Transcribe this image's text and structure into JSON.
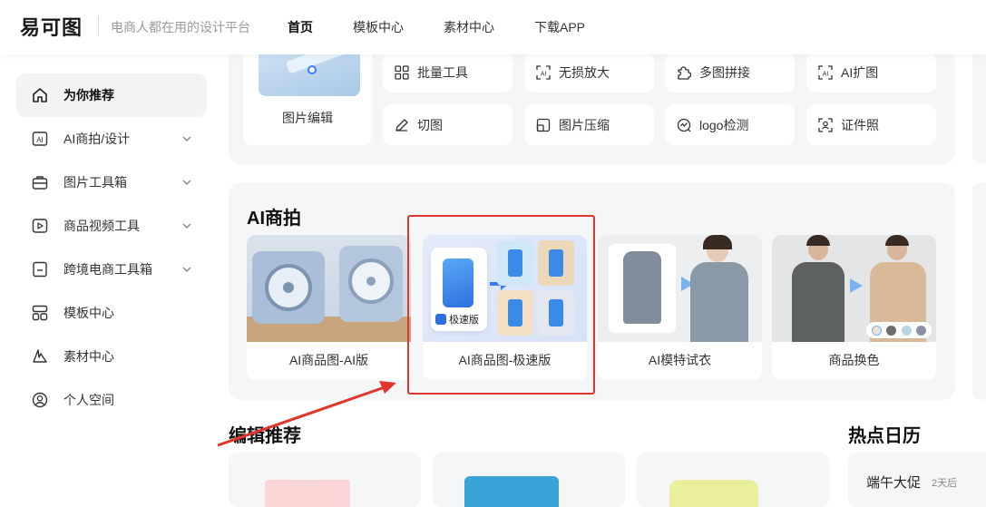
{
  "header": {
    "logo_text": "易可图",
    "slogan": "电商人都在用的设计平台",
    "nav": [
      "首页",
      "模板中心",
      "素材中心",
      "下载APP"
    ]
  },
  "sidebar": {
    "items": [
      {
        "label": "为你推荐",
        "icon": "home-icon",
        "expand": false
      },
      {
        "label": "AI商拍/设计",
        "icon": "ai-icon",
        "expand": true
      },
      {
        "label": "图片工具箱",
        "icon": "toolbox-icon",
        "expand": true
      },
      {
        "label": "商品视频工具",
        "icon": "video-icon",
        "expand": true
      },
      {
        "label": "跨境电商工具箱",
        "icon": "crossborder-icon",
        "expand": true
      },
      {
        "label": "模板中心",
        "icon": "template-icon",
        "expand": false
      },
      {
        "label": "素材中心",
        "icon": "material-icon",
        "expand": false
      },
      {
        "label": "个人空间",
        "icon": "user-icon",
        "expand": false
      }
    ]
  },
  "tools": {
    "image_edit_label": "图片编辑",
    "row1": [
      {
        "label": "批量工具",
        "icon": "grid-icon"
      },
      {
        "label": "无损放大",
        "icon": "ai-enlarge-icon"
      },
      {
        "label": "多图拼接",
        "icon": "puzzle-icon"
      },
      {
        "label": "AI扩图",
        "icon": "ai-expand-icon"
      }
    ],
    "row2": [
      {
        "label": "切图",
        "icon": "pen-icon"
      },
      {
        "label": "图片压缩",
        "icon": "compress-icon"
      },
      {
        "label": "logo检测",
        "icon": "logo-detect-icon"
      },
      {
        "label": "证件照",
        "icon": "id-photo-icon"
      }
    ]
  },
  "ai_section": {
    "title": "AI商拍",
    "cards": [
      {
        "label": "AI商品图-AI版"
      },
      {
        "label": "AI商品图-极速版",
        "badge": "极速版"
      },
      {
        "label": "AI模特试衣"
      },
      {
        "label": "商品换色"
      }
    ]
  },
  "edit_section": {
    "title": "编辑推荐"
  },
  "calendar": {
    "title": "热点日历",
    "item": "端午大促",
    "days": "2天后"
  },
  "colors": {
    "accent_red": "#e0362c",
    "panel_bg": "#f5f6f8",
    "blue": "#3a7bff"
  }
}
